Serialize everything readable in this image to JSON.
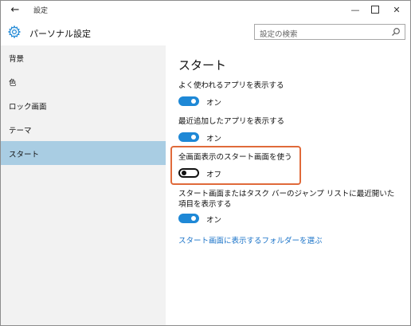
{
  "titlebar": {
    "back_glyph": "←",
    "title": "設定",
    "minimize_glyph": "—",
    "close_glyph": "✕"
  },
  "header": {
    "title": "パーソナル設定",
    "search_placeholder": "設定の検索"
  },
  "sidebar": {
    "items": [
      {
        "label": "背景"
      },
      {
        "label": "色"
      },
      {
        "label": "ロック画面"
      },
      {
        "label": "テーマ"
      },
      {
        "label": "スタート"
      }
    ],
    "selected": "スタート"
  },
  "main": {
    "title": "スタート",
    "settings": [
      {
        "label": "よく使われるアプリを表示する",
        "state": "オン"
      },
      {
        "label": "最近追加したアプリを表示する",
        "state": "オン"
      },
      {
        "label": "全画面表示のスタート画面を使う",
        "state": "オフ"
      },
      {
        "label": "スタート画面またはタスク バーのジャンプ リストに最近開いた項目を表示する",
        "state": "オン"
      }
    ],
    "link": "スタート画面に表示するフォルダーを選ぶ"
  },
  "colors": {
    "accent": "#1e88d6",
    "selection": "#a9cde3",
    "highlight_border": "#e06a3a",
    "link": "#1a73c8"
  }
}
